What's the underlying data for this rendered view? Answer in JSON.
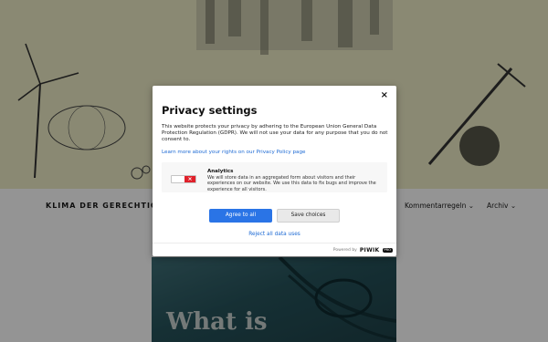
{
  "site": {
    "title": "KLIMA DER GERECHTIGK",
    "nav": [
      "Kommentarregeln",
      "Archiv"
    ],
    "feature_title": "What is"
  },
  "modal": {
    "close_label": "×",
    "title": "Privacy settings",
    "text": "This website protects your privacy by adhering to the European Union General Data Protection Regulation (GDPR). We will not use your data for any purpose that you do not consent to.",
    "link": "Learn more about your rights on our Privacy Policy page",
    "consent": {
      "title": "Analytics",
      "description": "We will store data in an aggregated form about visitors and their experiences on our website. We use this data to fix bugs and improve the experience for all visitors.",
      "toggle_state": "off"
    },
    "agree_label": "Agree to all",
    "save_label": "Save choices",
    "reject_label": "Reject all data uses",
    "powered_by": "Powered by",
    "brand": "PIWIK",
    "brand_badge": "PRO"
  },
  "colors": {
    "primary_button": "#2a74e6",
    "link": "#1d6ad4",
    "toggle_off": "#e0202a"
  }
}
